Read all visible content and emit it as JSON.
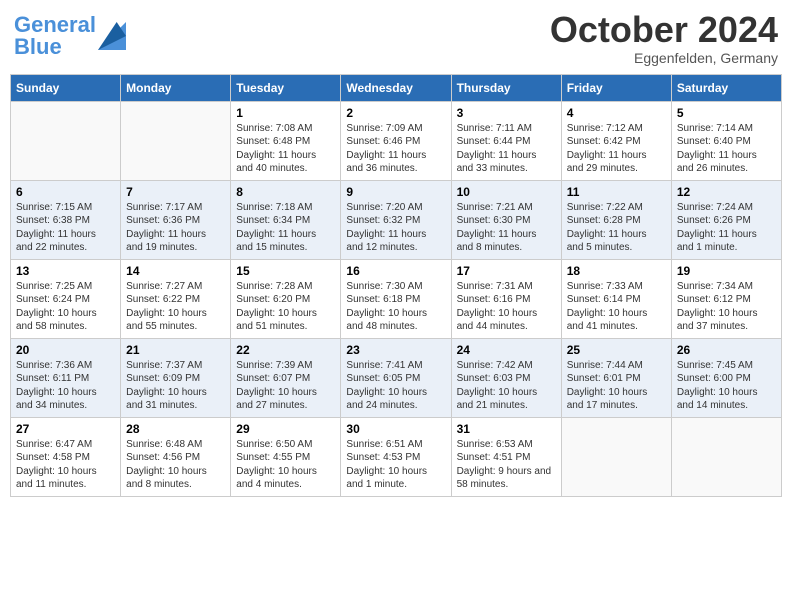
{
  "header": {
    "logo_general": "General",
    "logo_blue": "Blue",
    "month": "October 2024",
    "location": "Eggenfelden, Germany"
  },
  "columns": [
    "Sunday",
    "Monday",
    "Tuesday",
    "Wednesday",
    "Thursday",
    "Friday",
    "Saturday"
  ],
  "rows": [
    [
      {
        "day": "",
        "sunrise": "",
        "sunset": "",
        "daylight": ""
      },
      {
        "day": "",
        "sunrise": "",
        "sunset": "",
        "daylight": ""
      },
      {
        "day": "1",
        "sunrise": "Sunrise: 7:08 AM",
        "sunset": "Sunset: 6:48 PM",
        "daylight": "Daylight: 11 hours and 40 minutes."
      },
      {
        "day": "2",
        "sunrise": "Sunrise: 7:09 AM",
        "sunset": "Sunset: 6:46 PM",
        "daylight": "Daylight: 11 hours and 36 minutes."
      },
      {
        "day": "3",
        "sunrise": "Sunrise: 7:11 AM",
        "sunset": "Sunset: 6:44 PM",
        "daylight": "Daylight: 11 hours and 33 minutes."
      },
      {
        "day": "4",
        "sunrise": "Sunrise: 7:12 AM",
        "sunset": "Sunset: 6:42 PM",
        "daylight": "Daylight: 11 hours and 29 minutes."
      },
      {
        "day": "5",
        "sunrise": "Sunrise: 7:14 AM",
        "sunset": "Sunset: 6:40 PM",
        "daylight": "Daylight: 11 hours and 26 minutes."
      }
    ],
    [
      {
        "day": "6",
        "sunrise": "Sunrise: 7:15 AM",
        "sunset": "Sunset: 6:38 PM",
        "daylight": "Daylight: 11 hours and 22 minutes."
      },
      {
        "day": "7",
        "sunrise": "Sunrise: 7:17 AM",
        "sunset": "Sunset: 6:36 PM",
        "daylight": "Daylight: 11 hours and 19 minutes."
      },
      {
        "day": "8",
        "sunrise": "Sunrise: 7:18 AM",
        "sunset": "Sunset: 6:34 PM",
        "daylight": "Daylight: 11 hours and 15 minutes."
      },
      {
        "day": "9",
        "sunrise": "Sunrise: 7:20 AM",
        "sunset": "Sunset: 6:32 PM",
        "daylight": "Daylight: 11 hours and 12 minutes."
      },
      {
        "day": "10",
        "sunrise": "Sunrise: 7:21 AM",
        "sunset": "Sunset: 6:30 PM",
        "daylight": "Daylight: 11 hours and 8 minutes."
      },
      {
        "day": "11",
        "sunrise": "Sunrise: 7:22 AM",
        "sunset": "Sunset: 6:28 PM",
        "daylight": "Daylight: 11 hours and 5 minutes."
      },
      {
        "day": "12",
        "sunrise": "Sunrise: 7:24 AM",
        "sunset": "Sunset: 6:26 PM",
        "daylight": "Daylight: 11 hours and 1 minute."
      }
    ],
    [
      {
        "day": "13",
        "sunrise": "Sunrise: 7:25 AM",
        "sunset": "Sunset: 6:24 PM",
        "daylight": "Daylight: 10 hours and 58 minutes."
      },
      {
        "day": "14",
        "sunrise": "Sunrise: 7:27 AM",
        "sunset": "Sunset: 6:22 PM",
        "daylight": "Daylight: 10 hours and 55 minutes."
      },
      {
        "day": "15",
        "sunrise": "Sunrise: 7:28 AM",
        "sunset": "Sunset: 6:20 PM",
        "daylight": "Daylight: 10 hours and 51 minutes."
      },
      {
        "day": "16",
        "sunrise": "Sunrise: 7:30 AM",
        "sunset": "Sunset: 6:18 PM",
        "daylight": "Daylight: 10 hours and 48 minutes."
      },
      {
        "day": "17",
        "sunrise": "Sunrise: 7:31 AM",
        "sunset": "Sunset: 6:16 PM",
        "daylight": "Daylight: 10 hours and 44 minutes."
      },
      {
        "day": "18",
        "sunrise": "Sunrise: 7:33 AM",
        "sunset": "Sunset: 6:14 PM",
        "daylight": "Daylight: 10 hours and 41 minutes."
      },
      {
        "day": "19",
        "sunrise": "Sunrise: 7:34 AM",
        "sunset": "Sunset: 6:12 PM",
        "daylight": "Daylight: 10 hours and 37 minutes."
      }
    ],
    [
      {
        "day": "20",
        "sunrise": "Sunrise: 7:36 AM",
        "sunset": "Sunset: 6:11 PM",
        "daylight": "Daylight: 10 hours and 34 minutes."
      },
      {
        "day": "21",
        "sunrise": "Sunrise: 7:37 AM",
        "sunset": "Sunset: 6:09 PM",
        "daylight": "Daylight: 10 hours and 31 minutes."
      },
      {
        "day": "22",
        "sunrise": "Sunrise: 7:39 AM",
        "sunset": "Sunset: 6:07 PM",
        "daylight": "Daylight: 10 hours and 27 minutes."
      },
      {
        "day": "23",
        "sunrise": "Sunrise: 7:41 AM",
        "sunset": "Sunset: 6:05 PM",
        "daylight": "Daylight: 10 hours and 24 minutes."
      },
      {
        "day": "24",
        "sunrise": "Sunrise: 7:42 AM",
        "sunset": "Sunset: 6:03 PM",
        "daylight": "Daylight: 10 hours and 21 minutes."
      },
      {
        "day": "25",
        "sunrise": "Sunrise: 7:44 AM",
        "sunset": "Sunset: 6:01 PM",
        "daylight": "Daylight: 10 hours and 17 minutes."
      },
      {
        "day": "26",
        "sunrise": "Sunrise: 7:45 AM",
        "sunset": "Sunset: 6:00 PM",
        "daylight": "Daylight: 10 hours and 14 minutes."
      }
    ],
    [
      {
        "day": "27",
        "sunrise": "Sunrise: 6:47 AM",
        "sunset": "Sunset: 4:58 PM",
        "daylight": "Daylight: 10 hours and 11 minutes."
      },
      {
        "day": "28",
        "sunrise": "Sunrise: 6:48 AM",
        "sunset": "Sunset: 4:56 PM",
        "daylight": "Daylight: 10 hours and 8 minutes."
      },
      {
        "day": "29",
        "sunrise": "Sunrise: 6:50 AM",
        "sunset": "Sunset: 4:55 PM",
        "daylight": "Daylight: 10 hours and 4 minutes."
      },
      {
        "day": "30",
        "sunrise": "Sunrise: 6:51 AM",
        "sunset": "Sunset: 4:53 PM",
        "daylight": "Daylight: 10 hours and 1 minute."
      },
      {
        "day": "31",
        "sunrise": "Sunrise: 6:53 AM",
        "sunset": "Sunset: 4:51 PM",
        "daylight": "Daylight: 9 hours and 58 minutes."
      },
      {
        "day": "",
        "sunrise": "",
        "sunset": "",
        "daylight": ""
      },
      {
        "day": "",
        "sunrise": "",
        "sunset": "",
        "daylight": ""
      }
    ]
  ]
}
